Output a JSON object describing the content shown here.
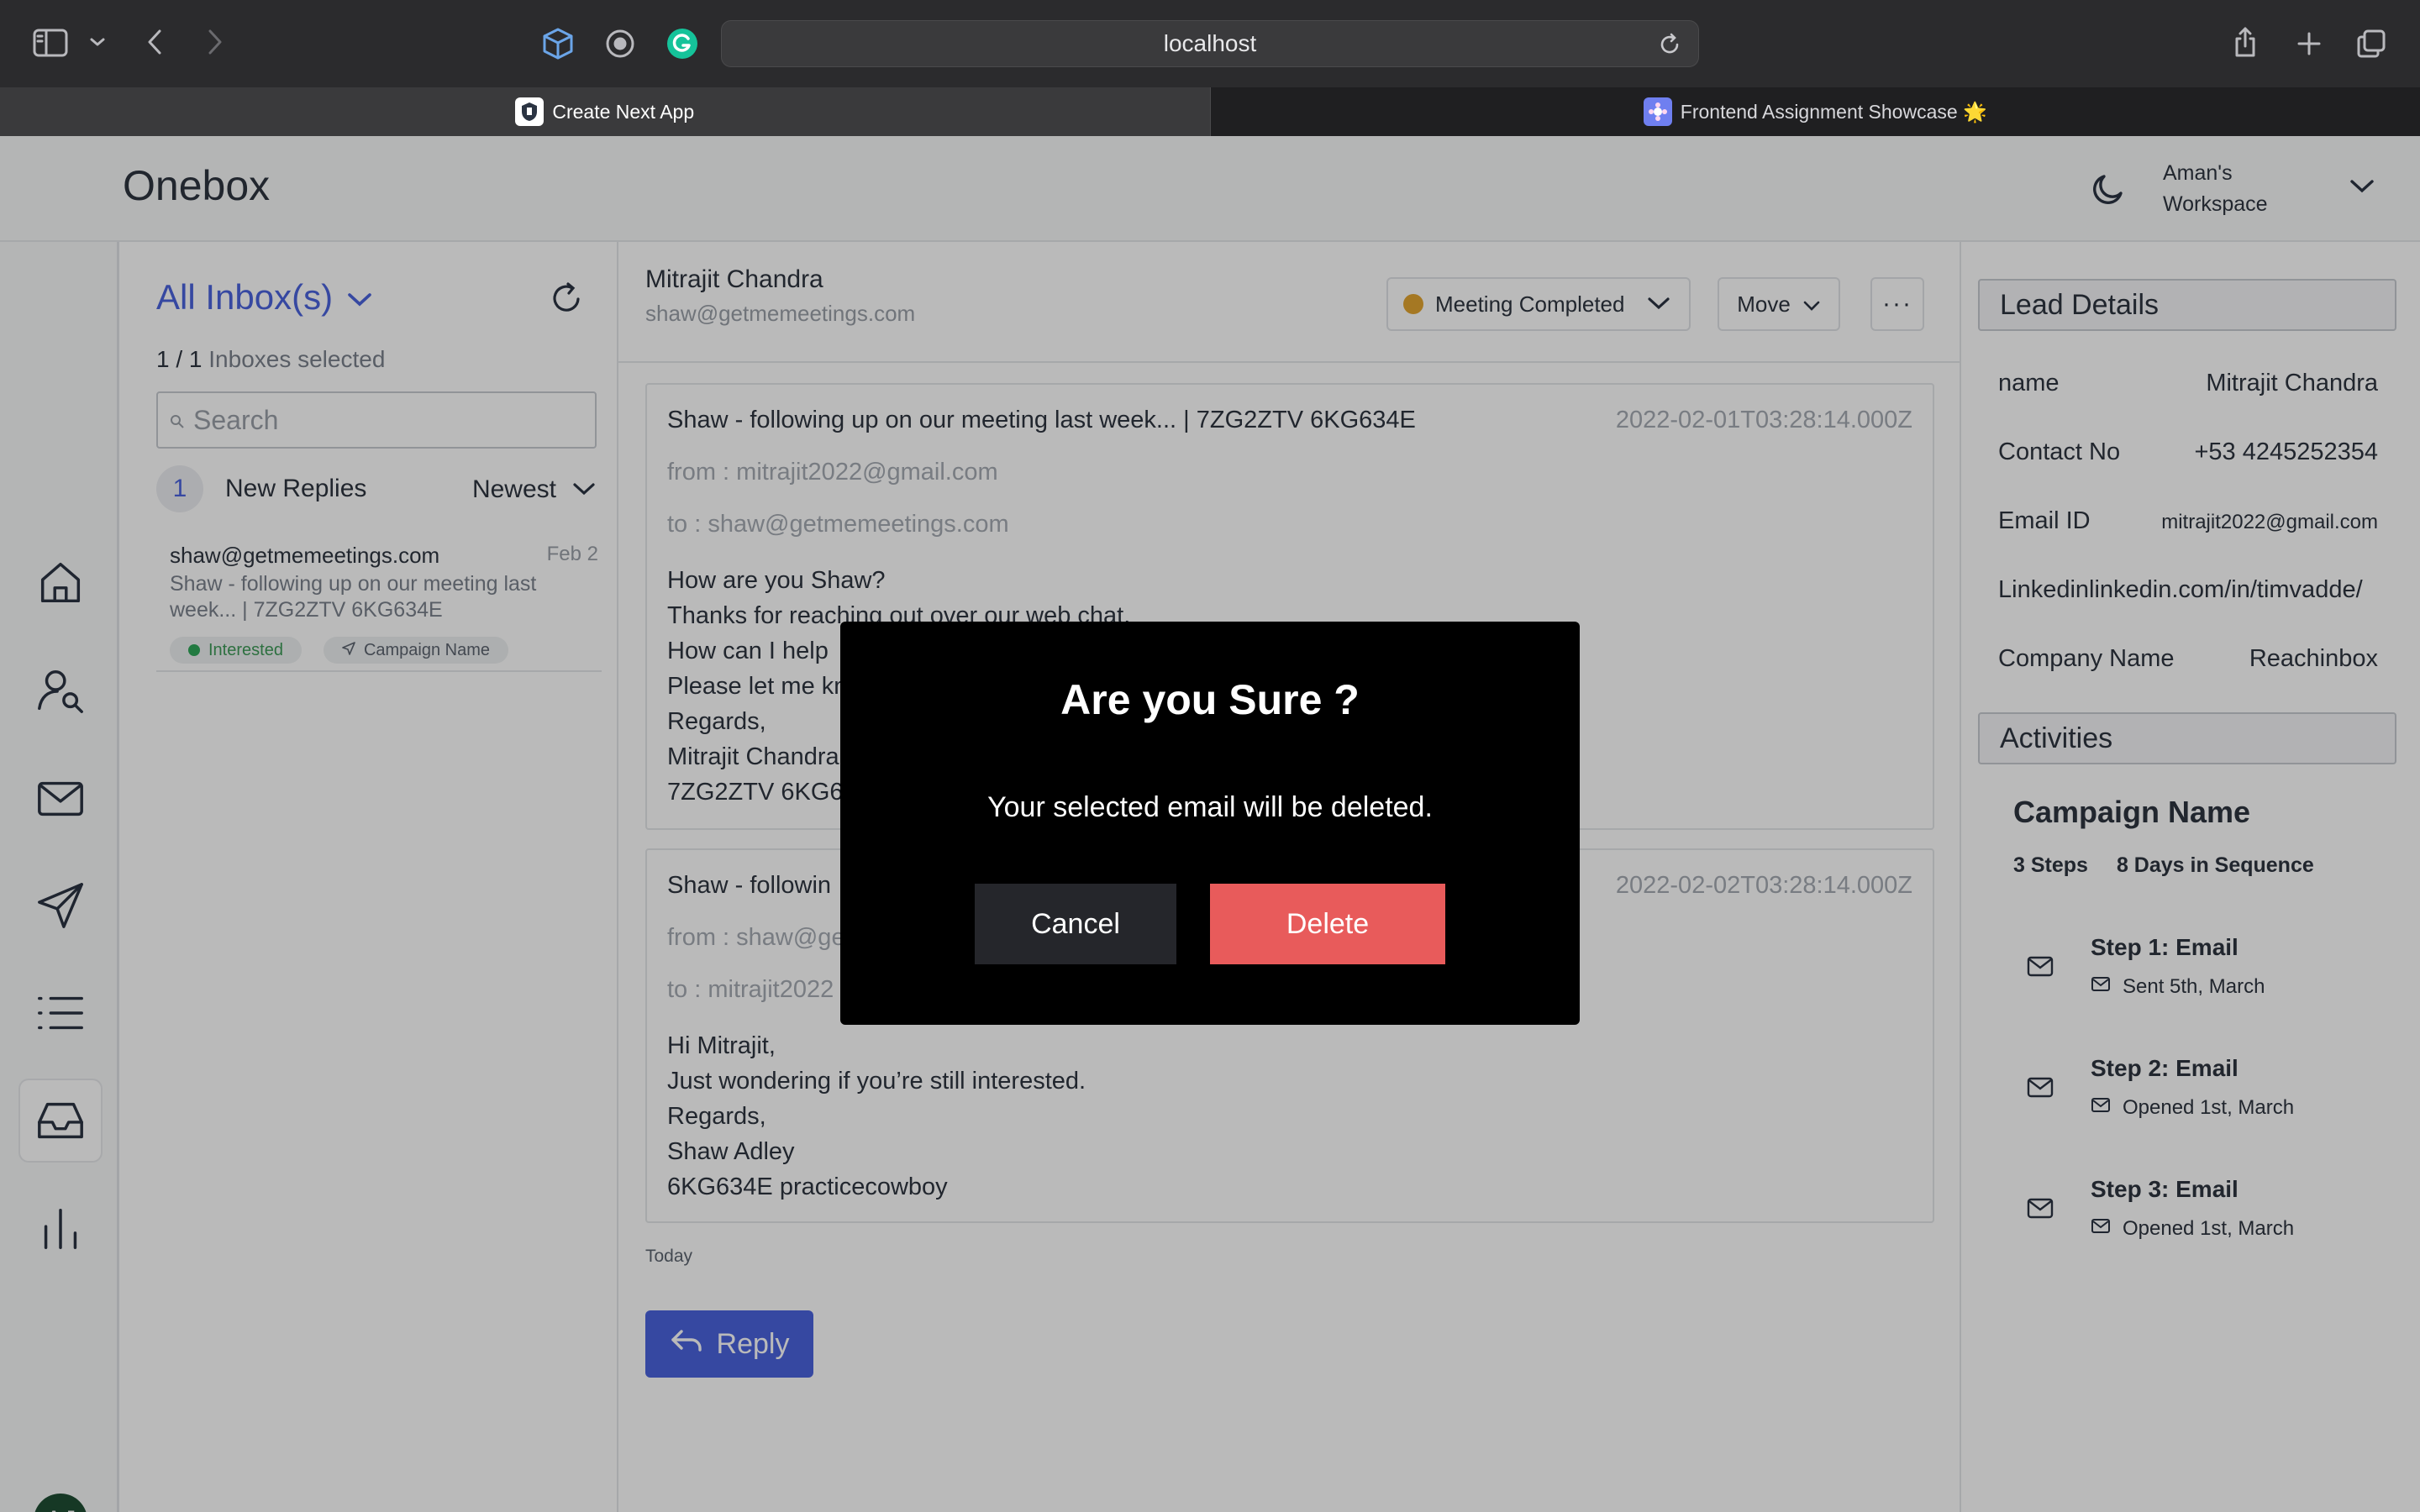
{
  "browser": {
    "url": "localhost",
    "tabs": [
      {
        "title": "Create Next App",
        "active": true
      },
      {
        "title": "Frontend Assignment Showcase 🌟",
        "active": false
      }
    ]
  },
  "app": {
    "title": "Onebox",
    "workspace_line1": "Aman's",
    "workspace_line2": "Workspace",
    "avatar_initials": "AJ",
    "accent_color": "#4b63dd"
  },
  "sidebar": {
    "items": [
      {
        "icon": "home-icon"
      },
      {
        "icon": "user-search-icon"
      },
      {
        "icon": "mail-icon"
      },
      {
        "icon": "send-icon"
      },
      {
        "icon": "list-icon"
      },
      {
        "icon": "inbox-icon",
        "active": true
      },
      {
        "icon": "bar-chart-icon"
      }
    ]
  },
  "inbox": {
    "title": "All Inbox(s)",
    "count_selected": "1 / 1",
    "count_label": "Inboxes selected",
    "search_placeholder": "Search",
    "new_replies_count": "1",
    "new_replies_label": "New Replies",
    "sort_label": "Newest",
    "threads": [
      {
        "from": "shaw@getmemeetings.com",
        "date": "Feb 2",
        "subject": "Shaw - following up on our meeting last week... | 7ZG2ZTV 6KG634E",
        "tags": [
          "Interested",
          "Campaign Name"
        ]
      }
    ]
  },
  "conversation": {
    "name": "Mitrajit Chandra",
    "email": "shaw@getmemeetings.com",
    "status": "Meeting Completed",
    "move_label": "Move",
    "more_label": "···",
    "emails": [
      {
        "subject": "Shaw - following up on our meeting last week... | 7ZG2ZTV 6KG634E",
        "timestamp": "2022-02-01T03:28:14.000Z",
        "from": "from : mitrajit2022@gmail.com",
        "to": "to : shaw@getmemeetings.com",
        "body": [
          "How are you Shaw?",
          "Thanks for reaching out over our web chat.",
          "How can I help",
          "Please let me kn",
          "Regards,",
          "Mitrajit Chandra",
          "7ZG2ZTV 6KG6"
        ]
      },
      {
        "subject": "Shaw - followin",
        "timestamp": "2022-02-02T03:28:14.000Z",
        "from": "from : shaw@ge",
        "to": "to : mitrajit2022",
        "body": [
          "Hi Mitrajit,",
          "Just wondering if you’re still interested.",
          "Regards,",
          "Shaw Adley",
          "6KG634E practicecowboy"
        ]
      }
    ],
    "day_label": "Today",
    "reply_label": "Reply"
  },
  "lead": {
    "title": "Lead Details",
    "fields": [
      {
        "label": "name",
        "value": "Mitrajit Chandra"
      },
      {
        "label": "Contact No",
        "value": "+53 4245252354"
      },
      {
        "label": "Email ID",
        "value": "mitrajit2022@gmail.com"
      },
      {
        "label": "Linkedin",
        "value": "linkedin.com/in/timvadde/"
      },
      {
        "label": "Company Name",
        "value": "Reachinbox"
      }
    ],
    "activities_title": "Activities",
    "campaign_name": "Campaign Name",
    "steps_count": "3 Steps",
    "days_label": "8 Days in Sequence",
    "steps": [
      {
        "title": "Step 1: Email",
        "status": "Sent 5th, March"
      },
      {
        "title": "Step 2: Email",
        "status": "Opened 1st, March"
      },
      {
        "title": "Step 3: Email",
        "status": "Opened 1st, March"
      }
    ]
  },
  "modal": {
    "title": "Are you Sure ?",
    "message": "Your selected email will be deleted.",
    "cancel_label": "Cancel",
    "delete_label": "Delete",
    "delete_color": "#e85b5b"
  }
}
